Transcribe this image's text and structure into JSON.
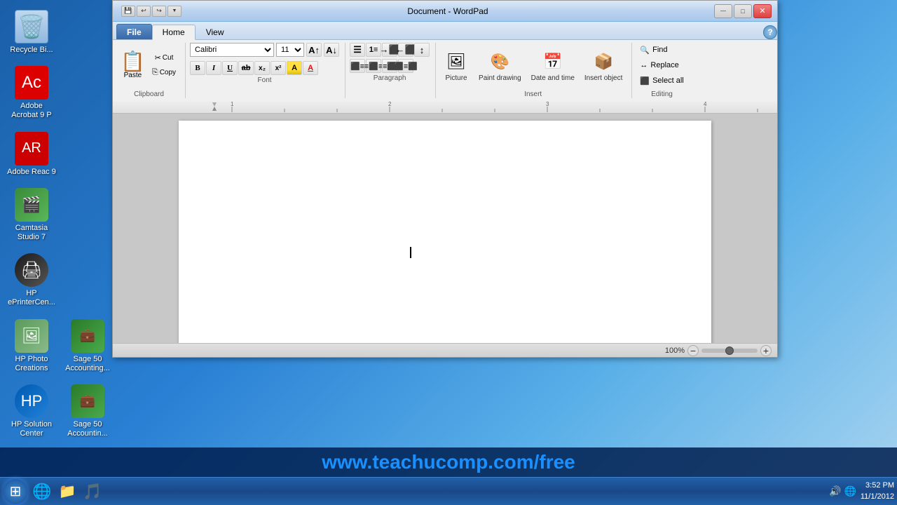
{
  "window": {
    "title": "Document - WordPad",
    "quickaccess": {
      "save_label": "💾",
      "undo_label": "↩",
      "redo_label": "↪"
    },
    "controls": {
      "minimize": "—",
      "maximize": "□",
      "close": "✕"
    }
  },
  "ribbon": {
    "tabs": [
      {
        "label": "File",
        "active": false
      },
      {
        "label": "Home",
        "active": true
      },
      {
        "label": "View",
        "active": false
      }
    ],
    "clipboard": {
      "label": "Clipboard",
      "paste_label": "Paste",
      "cut_label": "Cut",
      "copy_label": "Copy"
    },
    "font": {
      "label": "Font",
      "family": "Calibri",
      "size": "11",
      "bold": "B",
      "italic": "I",
      "underline": "U",
      "strikethrough": "ab",
      "subscript": "x₂",
      "superscript": "x²",
      "highlight_label": "A",
      "color_label": "A"
    },
    "paragraph": {
      "label": "Paragraph",
      "list": "☰",
      "numberedlist": "1.",
      "bullets": "•",
      "indent": "→",
      "outdent": "←",
      "alignleft": "⬛",
      "aligncenter": "⬛",
      "alignright": "⬛",
      "justify": "⬛",
      "linespacing": "↕"
    },
    "insert": {
      "label": "Insert",
      "picture_label": "Picture",
      "paintdrawing_label": "Paint drawing",
      "datetime_label": "Date and time",
      "insertobject_label": "Insert object"
    },
    "editing": {
      "label": "Editing",
      "find_label": "Find",
      "replace_label": "Replace",
      "selectall_label": "Select all"
    }
  },
  "document": {
    "content": "",
    "cursor_visible": true
  },
  "statusbar": {
    "zoom_percent": "100%",
    "zoom_minus": "−",
    "zoom_plus": "+"
  },
  "desktop": {
    "icons": [
      {
        "label": "Recycle Bi...",
        "icon": "🗑️"
      },
      {
        "label": "Adobe Acrobat 9 P",
        "icon": "📄"
      },
      {
        "label": "Adobe Reac 9",
        "icon": "📕"
      },
      {
        "label": "Camtasia Studio 7",
        "icon": "🎬"
      },
      {
        "label": "HP ePrinterCen...",
        "icon": "🖨️"
      },
      {
        "label": "HP Photo Creations",
        "icon": "🖼️"
      },
      {
        "label": "Sage 50 Accounting...",
        "icon": "💼"
      },
      {
        "label": "HP Solution Center",
        "icon": "💻"
      },
      {
        "label": "Sage 50 Accountin...",
        "icon": "💼"
      }
    ]
  },
  "taskbar": {
    "start_icon": "⊞",
    "icons": [
      {
        "name": "ie-icon",
        "symbol": "🌐"
      },
      {
        "name": "explorer-icon",
        "symbol": "📁"
      },
      {
        "name": "media-icon",
        "symbol": "▶️"
      }
    ],
    "time": "3:52 PM",
    "date": "11/1/2012"
  },
  "banner": {
    "text": "www.teachucomp.com/free"
  }
}
